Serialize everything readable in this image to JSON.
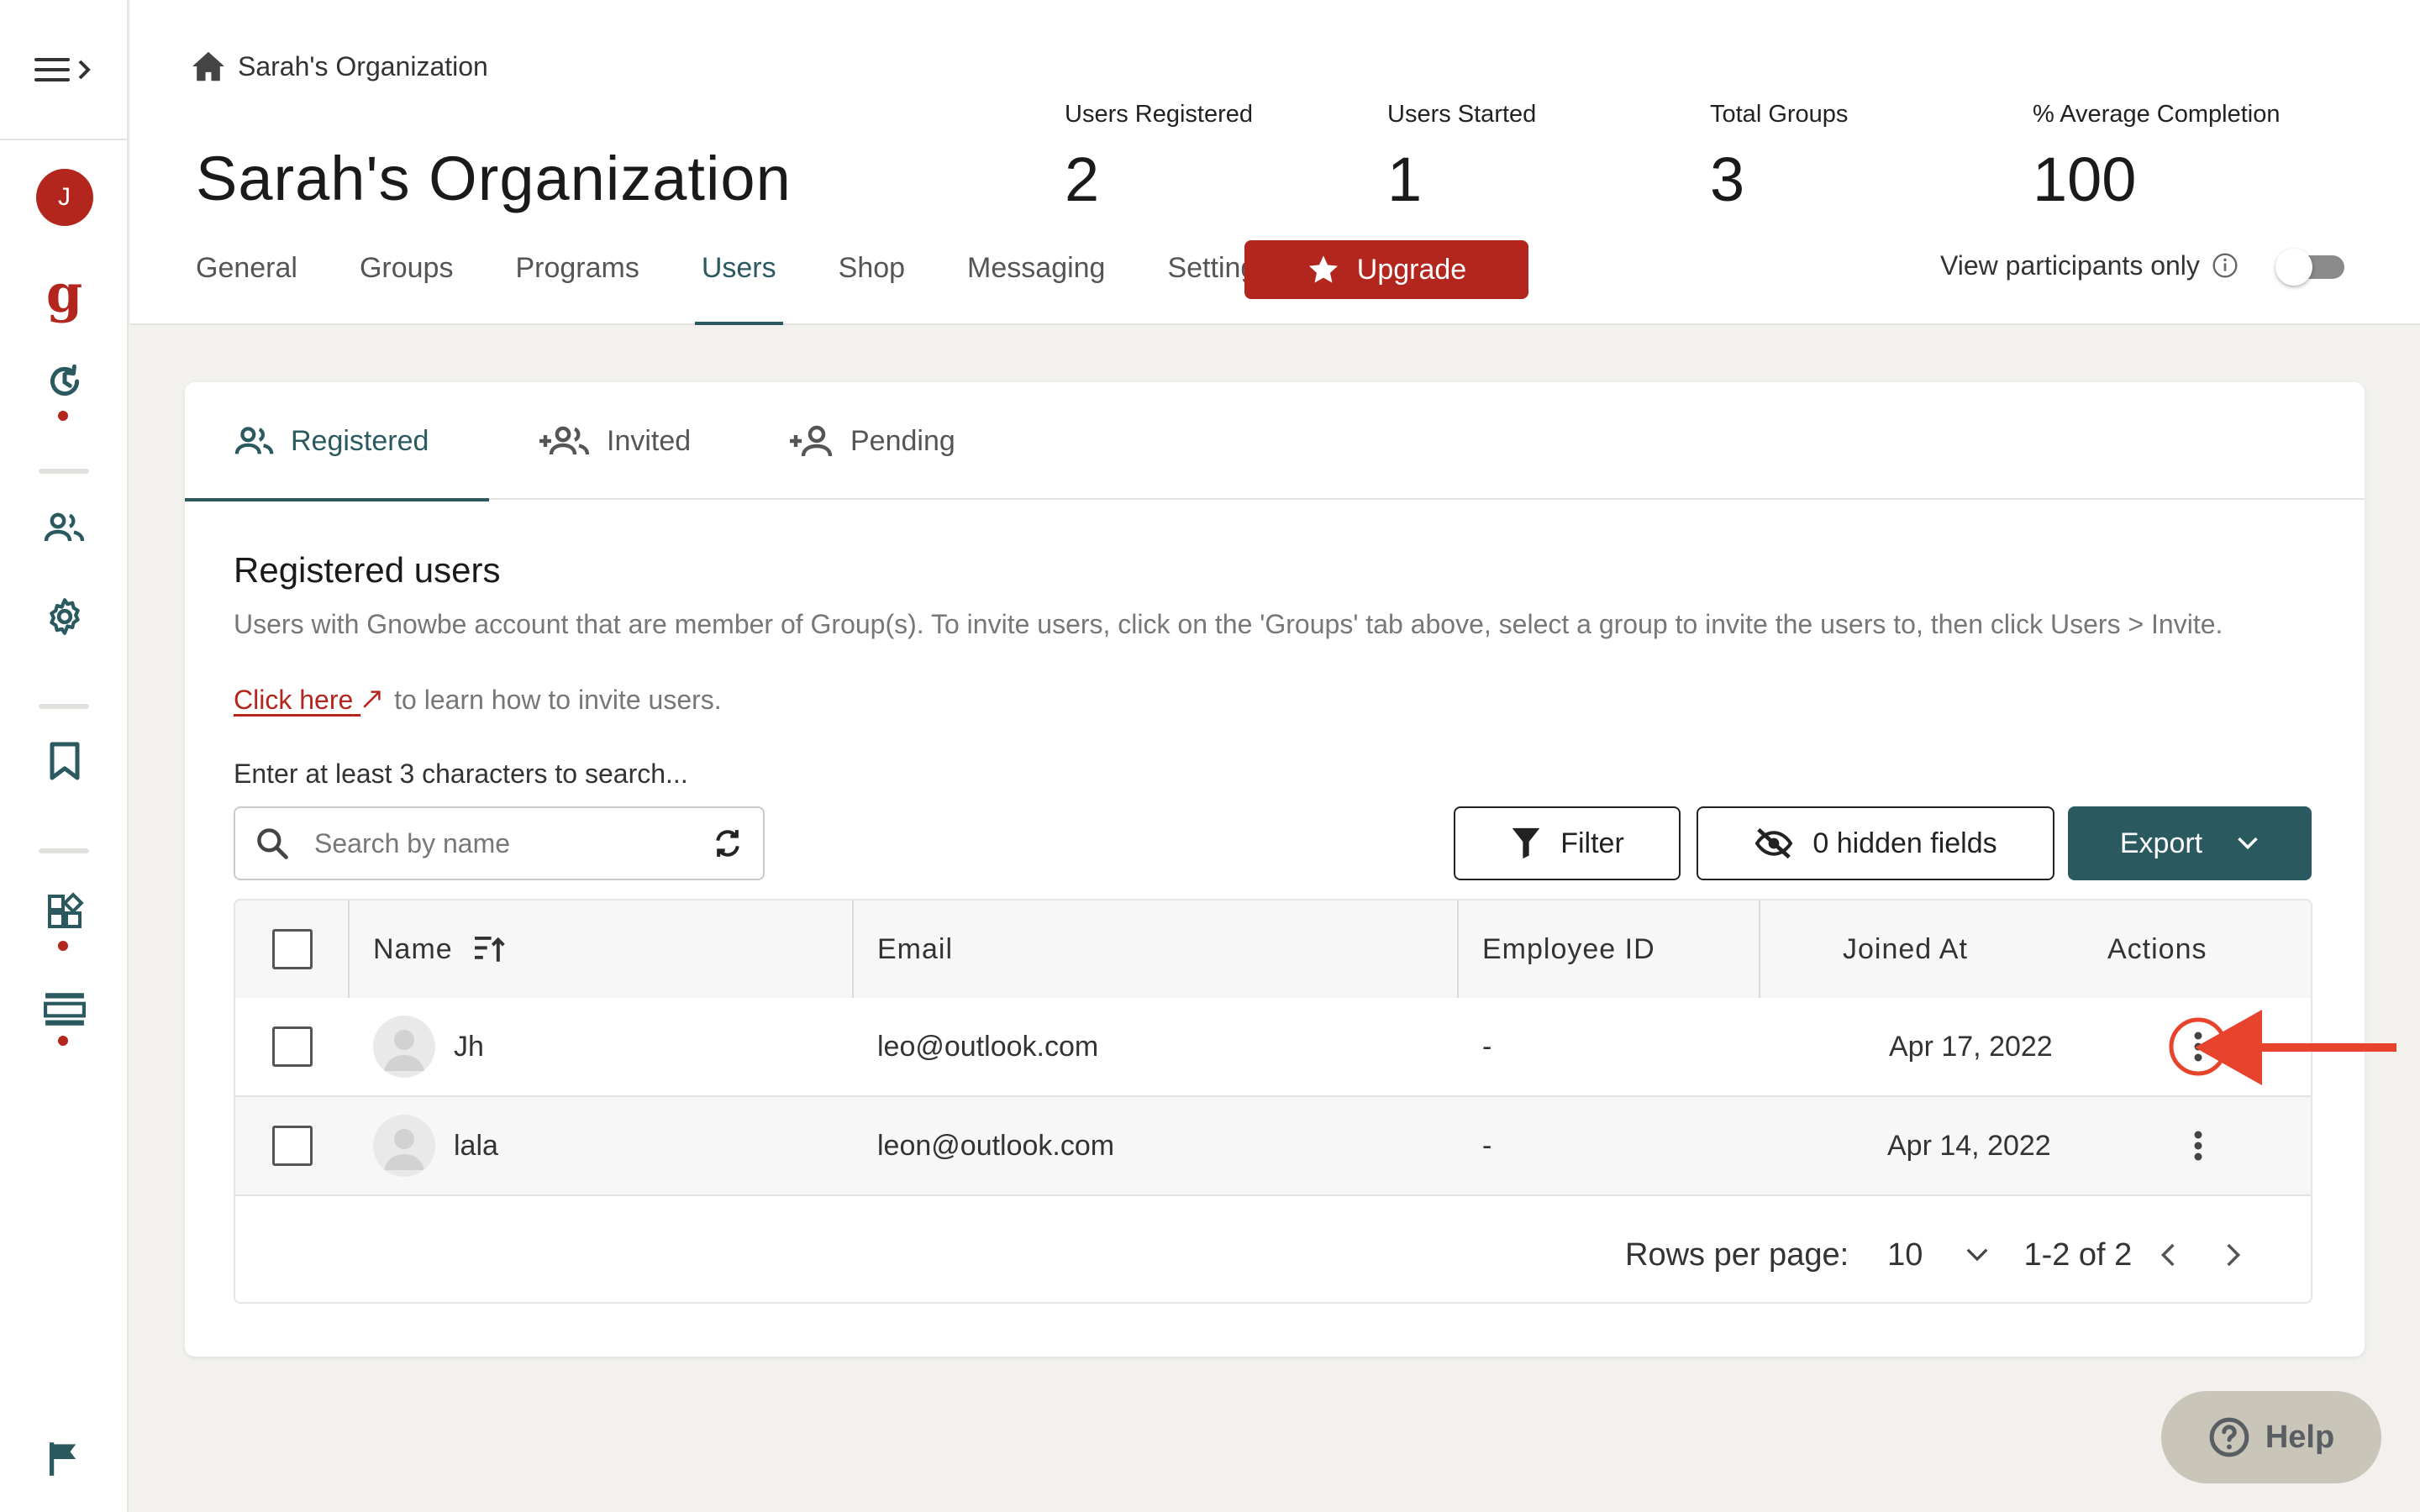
{
  "sidebar": {
    "avatar_initial": "J",
    "logo_letter": "g",
    "icons": [
      "menu-expand-icon",
      "history-icon",
      "users-icon",
      "gear-icon",
      "bookmark-icon",
      "widgets-icon",
      "list-view-icon",
      "flag-icon"
    ]
  },
  "header": {
    "breadcrumb": "Sarah's Organization",
    "title": "Sarah's Organization",
    "stats": [
      {
        "label": "Users Registered",
        "value": "2"
      },
      {
        "label": "Users Started",
        "value": "1"
      },
      {
        "label": "Total Groups",
        "value": "3"
      },
      {
        "label": "% Average Completion",
        "value": "100"
      }
    ],
    "tabs": [
      {
        "label": "General"
      },
      {
        "label": "Groups"
      },
      {
        "label": "Programs"
      },
      {
        "label": "Users",
        "active": true
      },
      {
        "label": "Shop"
      },
      {
        "label": "Messaging"
      },
      {
        "label": "Settings"
      }
    ],
    "upgrade_label": "Upgrade",
    "toggle_label": "View participants only",
    "toggle_on": false
  },
  "subtabs": [
    {
      "label": "Registered",
      "active": true
    },
    {
      "label": "Invited"
    },
    {
      "label": "Pending"
    }
  ],
  "section": {
    "title": "Registered users",
    "description": "Users with Gnowbe account that are member of Group(s). To invite users, click on the 'Groups' tab above, select a group to invite the users to, then click Users > Invite.",
    "link_text": "Click here",
    "link_suffix": "to learn how to invite users.",
    "search_hint": "Enter at least 3 characters to search...",
    "search_placeholder": "Search by name"
  },
  "toolbar": {
    "filter_label": "Filter",
    "hidden_fields_label": "0 hidden fields",
    "export_label": "Export"
  },
  "table": {
    "columns": [
      "Name",
      "Email",
      "Employee ID",
      "Joined At",
      "Actions"
    ],
    "rows": [
      {
        "name": "Jh",
        "email": "leo@outlook.com",
        "employee_id": "-",
        "joined_at": "Apr 17, 2022"
      },
      {
        "name": "lala",
        "email": "leon@outlook.com",
        "employee_id": "-",
        "joined_at": "Apr 14, 2022"
      }
    ],
    "rows_per_page_label": "Rows per page:",
    "rows_per_page_value": "10",
    "range_text": "1-2 of 2"
  },
  "help_label": "Help",
  "colors": {
    "accent_teal": "#2a5a5f",
    "brand_red": "#b3261e",
    "annotation_red": "#e8432c"
  }
}
